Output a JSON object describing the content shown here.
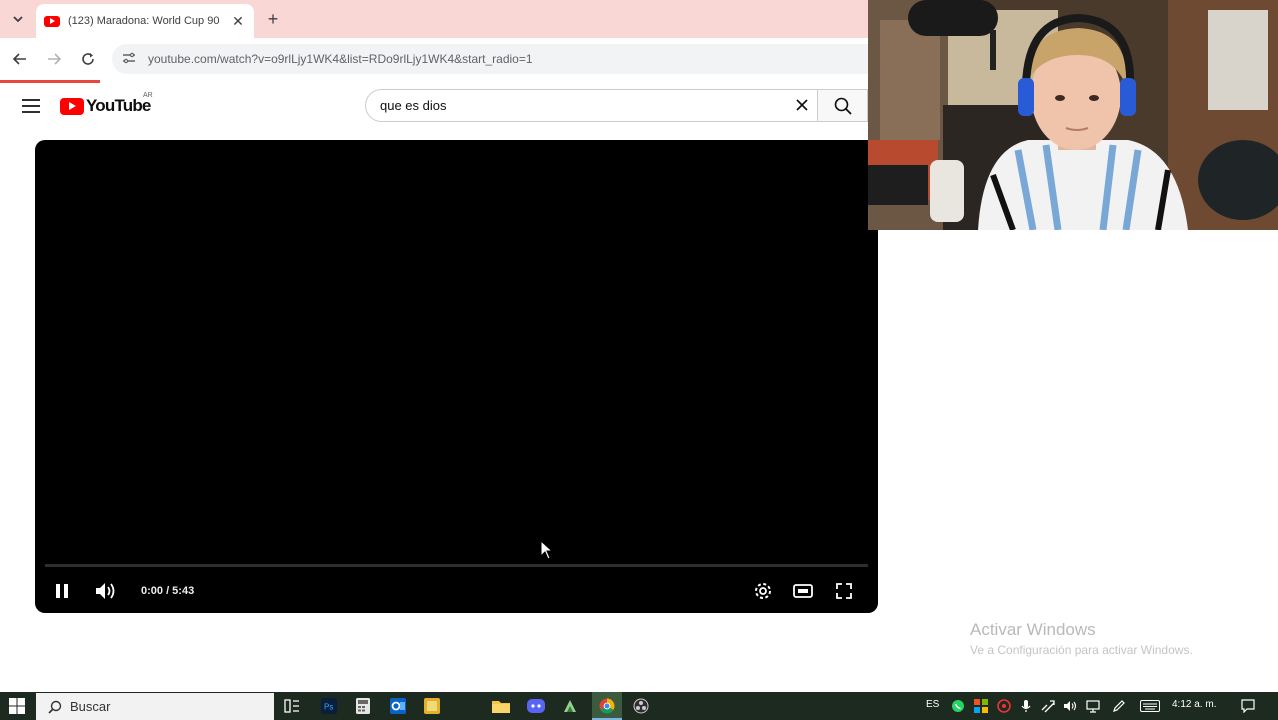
{
  "browser": {
    "tab_title": "(123) Maradona: World Cup 90",
    "tab_close": "✕",
    "new_tab": "+",
    "url": "youtube.com/watch?v=o9rlLjy1WK4&list=RDo9rlLjy1WK4&start_radio=1"
  },
  "youtube": {
    "logo_text": "YouTube",
    "country": "AR",
    "search_value": "que es dios"
  },
  "player": {
    "time": "0:00 / 5:43",
    "progress": 0
  },
  "webcam": {
    "scene": "person wearing blue headset and Argentina jersey, microphone at top"
  },
  "watermark": {
    "title": "Activar Windows",
    "subtitle": "Ve a Configuración para activar Windows."
  },
  "taskbar": {
    "search_placeholder": "Buscar",
    "language": "ES",
    "clock": "4:12 a. m.",
    "pinned": [
      "task-view-icon",
      "photoshop-icon",
      "calculator-icon",
      "outlook-icon",
      "notes-icon",
      "file-explorer-icon",
      "discord-icon",
      "app-icon",
      "chrome-icon",
      "obs-icon"
    ]
  },
  "colors": {
    "tabbar": "#f9d7d4",
    "youtube_red": "#ff0000",
    "taskbar": "#1d2a1f"
  }
}
